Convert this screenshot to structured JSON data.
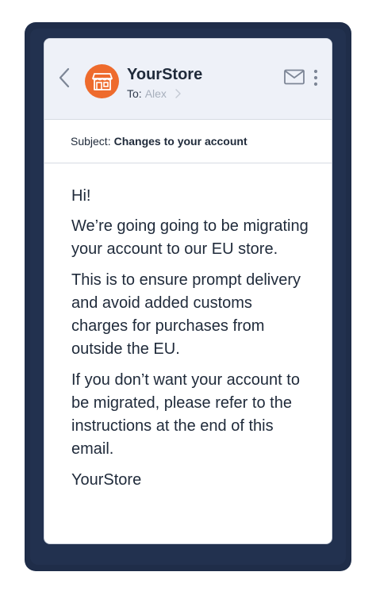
{
  "email": {
    "sender": "YourStore",
    "to_label": "To:",
    "recipient": "Alex",
    "subject_label": "Subject:",
    "subject": "Changes to your account",
    "body": {
      "greeting": "Hi!",
      "paragraph_1": "We’re going going to be migrating your account to our EU store.",
      "paragraph_2": "This is to ensure prompt delivery and avoid added customs charges for purchases from outside the EU.",
      "paragraph_3": "If you don’t want your account to be migrated, please refer to the instructions at the end of this email.",
      "signature": "YourStore"
    }
  },
  "icons": {
    "back": "chevron-left-icon",
    "avatar": "storefront-icon",
    "recipient_chevron": "chevron-right-icon",
    "mail": "envelope-icon",
    "more": "vertical-dots-icon"
  },
  "colors": {
    "avatar_bg": "#ee6b2d",
    "header_bg": "#eef1f8",
    "backdrop": "#1f2d49",
    "text": "#1f2a3a",
    "muted_text": "#a7afbc"
  }
}
